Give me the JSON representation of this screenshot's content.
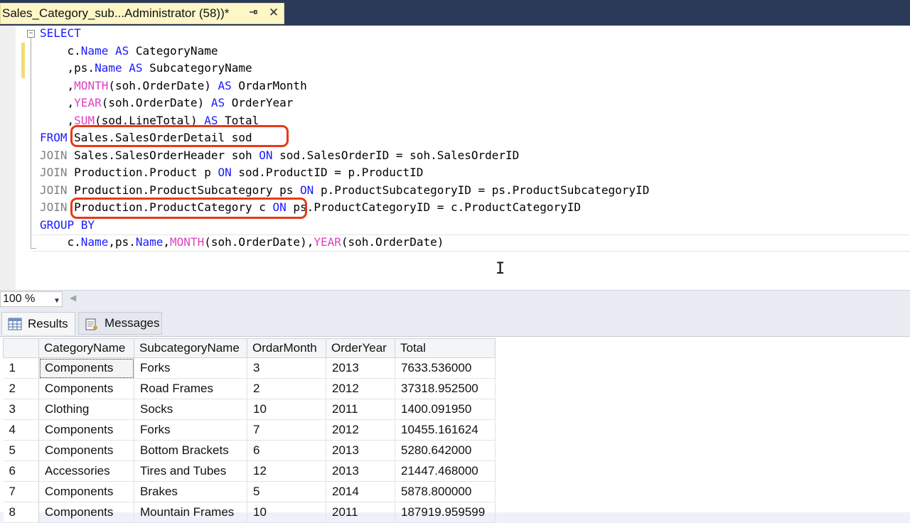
{
  "tab": {
    "title": "Sales_Category_sub...Administrator (58))*",
    "pin_icon": "pin-icon",
    "close_glyph": "✕"
  },
  "editor": {
    "fold_glyph": "−",
    "lines": [
      [
        "SELECT"
      ],
      [
        "    c.",
        "Name",
        " ",
        "AS",
        " CategoryName"
      ],
      [
        "    ,ps.",
        "Name",
        " ",
        "AS",
        " SubcategoryName"
      ],
      [
        "    ,",
        "MONTH",
        "(soh.OrderDate) ",
        "AS",
        " OrdarMonth"
      ],
      [
        "    ,",
        "YEAR",
        "(soh.OrderDate) ",
        "AS",
        " OrderYear"
      ],
      [
        "    ,",
        "SUM",
        "(sod.LineTotal) ",
        "AS",
        " Total"
      ],
      [
        "FROM",
        " Sales.SalesOrderDetail sod"
      ],
      [
        "JOIN",
        " Sales.SalesOrderHeader soh ",
        "ON",
        " sod.SalesOrderID = soh.SalesOrderID"
      ],
      [
        "JOIN",
        " Production.Product p ",
        "ON",
        " sod.ProductID = p.ProductID"
      ],
      [
        "JOIN",
        " Production.ProductSubcategory ps ",
        "ON",
        " p.ProductSubcategoryID = ps.ProductSubcategoryID"
      ],
      [
        "JOIN",
        " Production.ProductCategory c ",
        "ON",
        " ps.ProductCategoryID = c.ProductCategoryID"
      ],
      [
        "GROUP BY"
      ],
      [
        "    c.",
        "Name",
        ",ps.",
        "Name",
        ",",
        "MONTH",
        "(soh.OrderDate),",
        "YEAR",
        "(soh.OrderDate)"
      ]
    ]
  },
  "zoom": {
    "value": "100 %"
  },
  "results_tabs": {
    "results_label": "Results",
    "messages_label": "Messages",
    "results_icon": "grid-icon",
    "messages_icon": "messages-icon"
  },
  "grid": {
    "columns": [
      "CategoryName",
      "SubcategoryName",
      "OrdarMonth",
      "OrderYear",
      "Total"
    ],
    "rows": [
      [
        "1",
        "Components",
        "Forks",
        "3",
        "2013",
        "7633.536000"
      ],
      [
        "2",
        "Components",
        "Road Frames",
        "2",
        "2012",
        "37318.952500"
      ],
      [
        "3",
        "Clothing",
        "Socks",
        "10",
        "2011",
        "1400.091950"
      ],
      [
        "4",
        "Components",
        "Forks",
        "7",
        "2012",
        "10455.161624"
      ],
      [
        "5",
        "Components",
        "Bottom Brackets",
        "6",
        "2013",
        "5280.642000"
      ],
      [
        "6",
        "Accessories",
        "Tires and Tubes",
        "12",
        "2013",
        "21447.468000"
      ],
      [
        "7",
        "Components",
        "Brakes",
        "5",
        "2014",
        "5878.800000"
      ],
      [
        "8",
        "Components",
        "Mountain Frames",
        "10",
        "2011",
        "187919.959599"
      ]
    ]
  },
  "colors": {
    "keyword": "#1a1aff",
    "function": "#e040c0",
    "highlight": "#e63a16",
    "tab_background": "#fdf6c7"
  }
}
